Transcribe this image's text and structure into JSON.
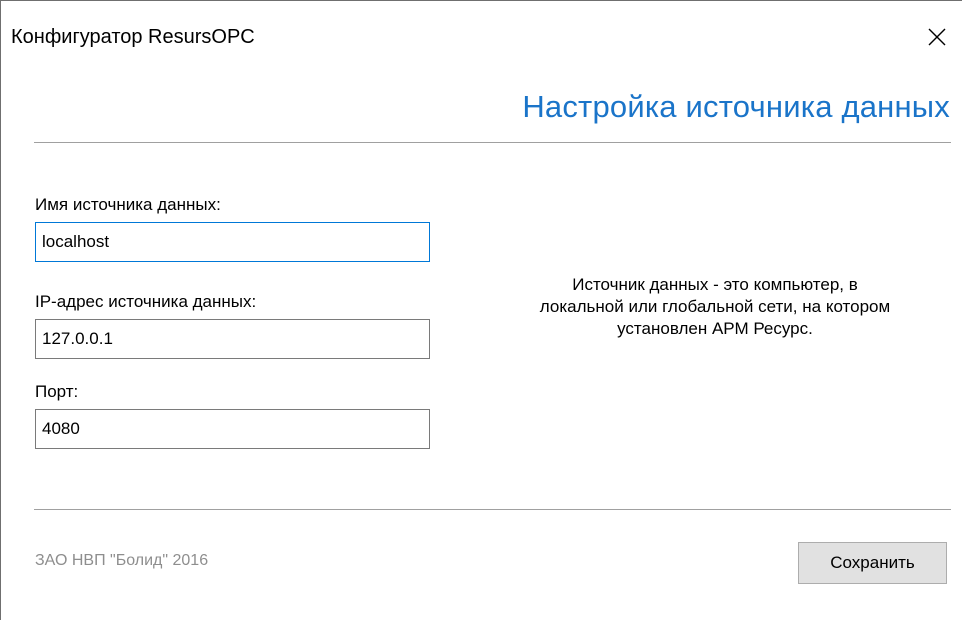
{
  "window": {
    "title": "Конфигуратор ResursOPC"
  },
  "header": {
    "title": "Настройка источника данных"
  },
  "form": {
    "name_label": "Имя источника данных:",
    "name_value": "localhost",
    "ip_label": "IP-адрес источника данных:",
    "ip_value": "127.0.0.1",
    "port_label": "Порт:",
    "port_value": "4080"
  },
  "info": {
    "lines": [
      "Источник данных - это компьютер, в",
      "локальной или глобальной сети, на котором",
      "установлен АРМ Ресурс."
    ]
  },
  "footer": {
    "copyright": "ЗАО НВП \"Болид\" 2016",
    "save_label": "Сохранить"
  },
  "icons": {
    "close": "close-icon"
  },
  "colors": {
    "heading_accent": "#1a74c9",
    "focus_border": "#0078d7",
    "footer_text": "#8e8e8e"
  }
}
